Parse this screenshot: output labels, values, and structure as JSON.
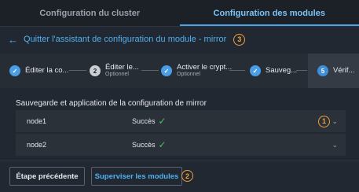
{
  "tabs": [
    {
      "label": "Configuration du cluster",
      "active": false
    },
    {
      "label": "Configuration des modules",
      "active": true
    }
  ],
  "back_link": {
    "label": "Quitter l'assistant de configuration du module - mirror",
    "callout": "3"
  },
  "stepper": {
    "steps": [
      {
        "label": "Éditer la co...",
        "state": "done"
      },
      {
        "number": "2",
        "label": "Éditer le...",
        "sub": "Optionnel",
        "state": "pending"
      },
      {
        "label": "Activer le crypt...",
        "sub": "Optionnel",
        "state": "done"
      },
      {
        "label": "Sauveg...",
        "state": "done"
      },
      {
        "number": "5",
        "label": "Vérif...",
        "state": "current"
      }
    ]
  },
  "section_title": "Sauvegarde et application de la configuration de mirror",
  "nodes": [
    {
      "name": "node1",
      "status": "Succès",
      "callout": "1"
    },
    {
      "name": "node2",
      "status": "Succès"
    }
  ],
  "footer": {
    "prev_label": "Étape précédente",
    "supervise_label": "Superviser les modules",
    "supervise_callout": "2"
  },
  "colors": {
    "accent": "#4fb0f0",
    "success": "#49c15a",
    "callout": "#f2a13a"
  }
}
